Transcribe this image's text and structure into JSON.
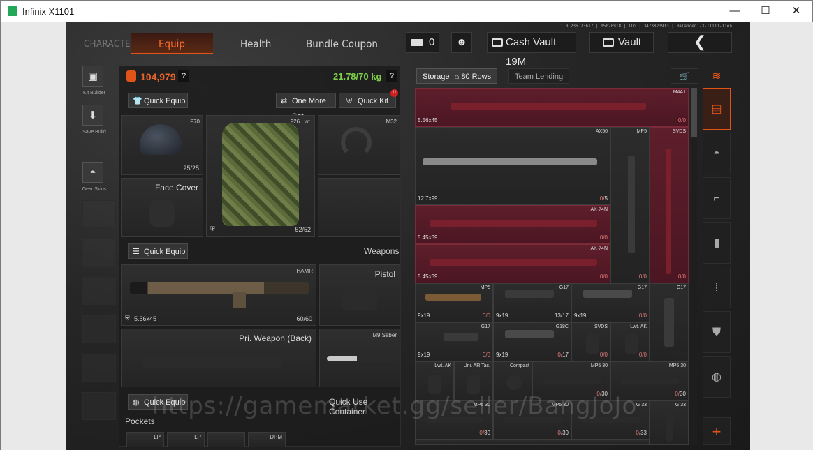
{
  "window": {
    "title": "Infinix X1101",
    "minimize": "—",
    "maximize": "☐",
    "close": "✕"
  },
  "version": "1.0.236.23617 | 05020918 | TCG | 3473823913 | Balanced1-3-11111-11en",
  "nav": {
    "character": "CHARACTER",
    "tabs": [
      "Equip",
      "Health",
      "Bundle Coupon"
    ]
  },
  "header": {
    "ticket_count": "0",
    "cash_vault": "Cash Vault 19M",
    "vault": "Vault",
    "back_icon": "chevron-left-icon"
  },
  "left_sidebar": {
    "kit_builder": "Kit Builder",
    "save_build": "Save Build",
    "gear_skins": "Gear Skins"
  },
  "loadout": {
    "value": "104,979",
    "help": "?",
    "weight": "21.78/70 kg",
    "quick_equip": "Quick Equip",
    "one_more_set": "One More Set",
    "quick_kit": "Quick Kit",
    "quick_kit_badge": "11",
    "helmet": {
      "name": "F70",
      "count": "25/25"
    },
    "vest": {
      "name": "926 Lwt.",
      "count": "52/52"
    },
    "headset": {
      "name": "M32"
    },
    "face_cover": "Face Cover",
    "weapons_header": "Weapons",
    "weapons_quick_equip": "Quick Equip",
    "primary": {
      "name": "HAMR",
      "caliber": "5.56x45",
      "count": "60/60"
    },
    "pistol": "Pistol",
    "pri_back": "Pri. Weapon (Back)",
    "melee": {
      "name": "M9 Saber"
    },
    "container_quick_equip": "Quick Equip",
    "container_header": "Quick Use Container",
    "pockets": "Pockets",
    "pocket_slots": [
      "LP",
      "LP",
      "",
      "DPM"
    ]
  },
  "storage": {
    "tab": "Storage",
    "rows": "80 Rows",
    "team_lending": "Team Lending",
    "items": [
      {
        "name": "M4A1",
        "caliber": "5.56x45",
        "count": "0",
        "cap": "0"
      },
      {
        "name": "AX50",
        "caliber": "12.7x99",
        "count": "0",
        "cap": "5"
      },
      {
        "name": "MP5",
        "caliber": "",
        "count": "0",
        "cap": "0"
      },
      {
        "name": "SVDS",
        "caliber": "",
        "count": "0",
        "cap": "0"
      },
      {
        "name": "AK-74N",
        "caliber": "5.45x39",
        "count": "0",
        "cap": "0"
      },
      {
        "name": "AK-74N",
        "caliber": "5.45x39",
        "count": "0",
        "cap": "0"
      },
      {
        "name": "MP5",
        "caliber": "9x19",
        "count": "0",
        "cap": "0"
      },
      {
        "name": "G17",
        "caliber": "9x19",
        "count": "13",
        "cap": "17"
      },
      {
        "name": "G17",
        "caliber": "9x19",
        "count": "0",
        "cap": "0"
      },
      {
        "name": "G17",
        "caliber": "",
        "count": "",
        "cap": ""
      },
      {
        "name": "G17",
        "caliber": "9x19",
        "count": "0",
        "cap": "0"
      },
      {
        "name": "G18C",
        "caliber": "9x19",
        "count": "0",
        "cap": "17"
      },
      {
        "name": "SVDS",
        "caliber": "",
        "count": "0",
        "cap": "0"
      },
      {
        "name": "Lwt. AK",
        "caliber": "",
        "count": "0",
        "cap": "0"
      },
      {
        "name": "Lwt. AK",
        "caliber": "",
        "count": "",
        "cap": ""
      },
      {
        "name": "Uni. AR Tac.",
        "caliber": "",
        "count": "",
        "cap": ""
      },
      {
        "name": "Compact",
        "caliber": "",
        "count": "",
        "cap": ""
      },
      {
        "name": "MP5 30",
        "caliber": "",
        "count": "0",
        "cap": "30"
      },
      {
        "name": "MP5 30",
        "caliber": "",
        "count": "0",
        "cap": "30"
      },
      {
        "name": "MP5 30",
        "caliber": "",
        "count": "0",
        "cap": "30"
      },
      {
        "name": "MP5 30",
        "caliber": "",
        "count": "0",
        "cap": "30"
      },
      {
        "name": "G 33",
        "caliber": "",
        "count": "0",
        "cap": "33"
      },
      {
        "name": "G 33",
        "caliber": "",
        "count": "",
        "cap": ""
      }
    ]
  },
  "right_categories": [
    "layers-icon",
    "helmet-icon",
    "rifle-icon",
    "magazine-icon",
    "ammo-icon",
    "armor-icon",
    "grenade-icon"
  ],
  "add": "+",
  "watermark": "https://gamemarket.gg/seller/BangJoJo",
  "colors": {
    "accent": "#e0541a",
    "weight_ok": "#7fd14a",
    "red_cell": "#5e1e2b",
    "warn": "#e07a7a"
  }
}
